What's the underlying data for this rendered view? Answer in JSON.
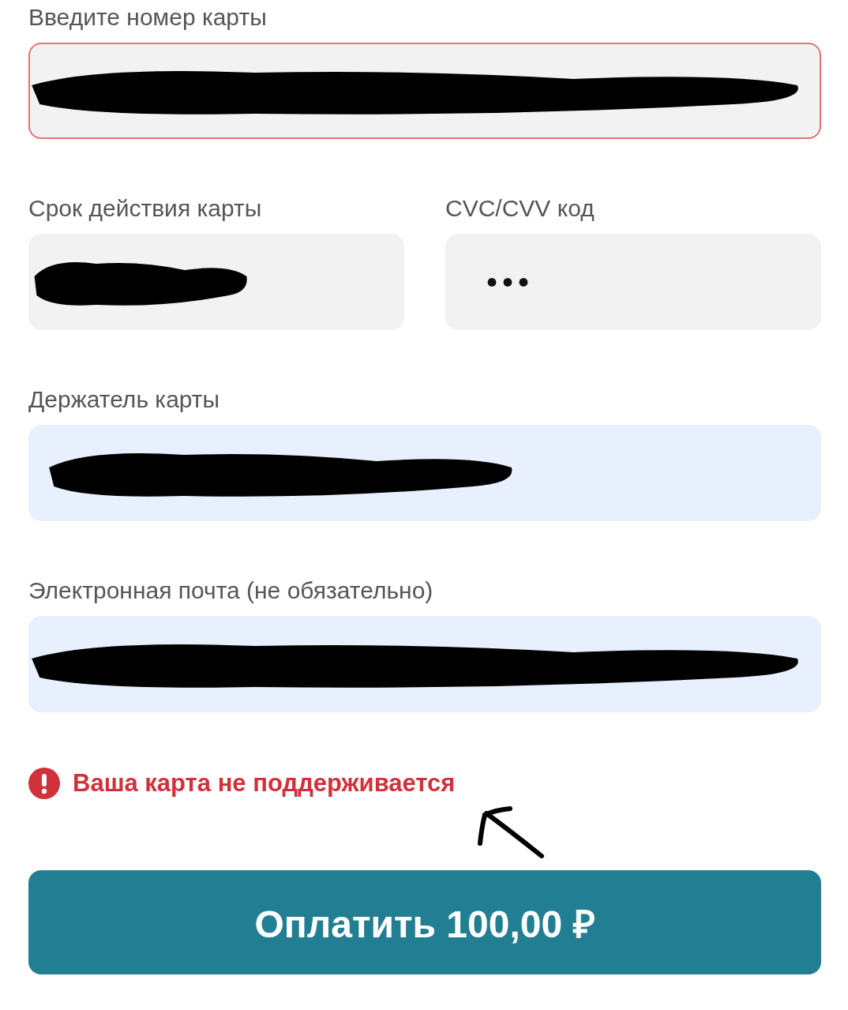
{
  "card_number": {
    "label": "Введите номер карты",
    "invalid": true,
    "redacted": true
  },
  "expiry": {
    "label": "Срок действия карты",
    "redacted": true
  },
  "cvc": {
    "label": "CVC/CVV код",
    "value": "•••"
  },
  "holder": {
    "label": "Держатель карты",
    "autofilled": true,
    "redacted": true
  },
  "email": {
    "label": "Электронная почта (не обязательно)",
    "autofilled": true,
    "redacted": true
  },
  "error": {
    "text": "Ваша карта не поддерживается"
  },
  "pay_button": {
    "label": "Оплатить 100,00 ₽"
  }
}
